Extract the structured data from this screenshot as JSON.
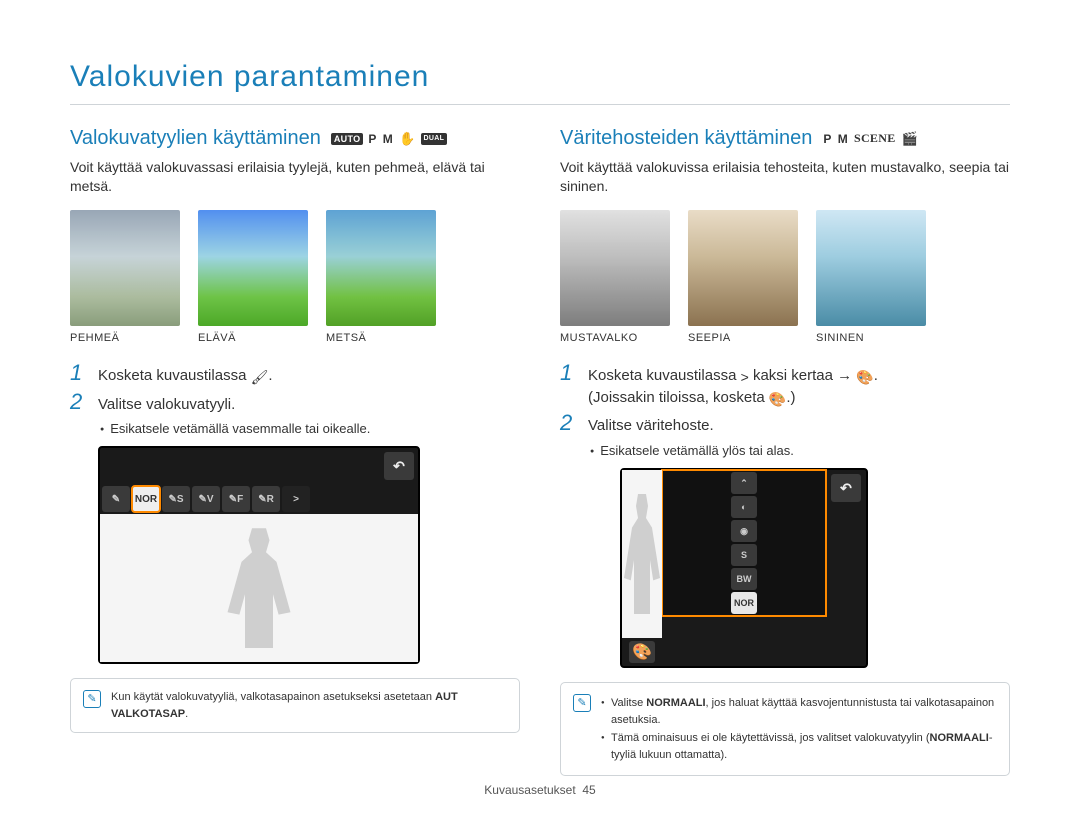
{
  "page": {
    "title": "Valokuvien parantaminen",
    "footer_section": "Kuvausasetukset",
    "footer_page": "45"
  },
  "left": {
    "title": "Valokuvatyylien käyttäminen",
    "modes": {
      "auto": "AUTO",
      "p": "P",
      "m": "M",
      "dual": "DUAL"
    },
    "intro": "Voit käyttää valokuvassasi erilaisia tyylejä, kuten pehmeä, elävä tai metsä.",
    "thumbs": [
      {
        "label": "PEHMEÄ"
      },
      {
        "label": "ELÄVÄ"
      },
      {
        "label": "METSÄ"
      }
    ],
    "step1": "Kosketa kuvaustilassa",
    "step1_icon": "🖌",
    "step2": "Valitse valokuvatyyli.",
    "bullet": "Esikatsele vetämällä vasemmalle tai oikealle.",
    "screen": {
      "back": "↶",
      "options": [
        "✎",
        "NOR",
        "✎S",
        "✎V",
        "✎F",
        "✎R"
      ],
      "next": ">"
    },
    "note": {
      "text_a": "Kun käytät valokuvatyyliä, valkotasapainon asetukseksi asetetaan ",
      "text_b": "AUT VALKOTASAP",
      "text_c": "."
    }
  },
  "right": {
    "title": "Väritehosteiden käyttäminen",
    "modes": {
      "p": "P",
      "m": "M",
      "scene": "SCENE"
    },
    "intro": "Voit käyttää valokuvissa erilaisia tehosteita, kuten mustavalko, seepia tai sininen.",
    "thumbs": [
      {
        "label": "MUSTAVALKO"
      },
      {
        "label": "SEEPIA"
      },
      {
        "label": "SININEN"
      }
    ],
    "step1_a": "Kosketa kuvaustilassa",
    "step1_b": "kaksi kertaa",
    "step1_c": "(Joissakin tiloissa, kosketa",
    "step1_d": ".)",
    "step1_chevron": ">",
    "step1_arrow": "→",
    "step1_icon": "🎨",
    "step2": "Valitse väritehoste.",
    "bullet": "Esikatsele vetämällä ylös tai alas.",
    "screen": {
      "back": "↶",
      "options_top": "⌃",
      "options": [
        "◐",
        "◉",
        "S",
        "BW",
        "NOR"
      ],
      "palette": "🎨"
    },
    "note": {
      "li1_a": "Valitse ",
      "li1_b": "NORMAALI",
      "li1_c": ", jos haluat käyttää kasvojentunnistusta tai valkotasapainon asetuksia.",
      "li2_a": "Tämä ominaisuus ei ole käytettävissä, jos valitset valokuvatyylin (",
      "li2_b": "NORMAALI",
      "li2_c": "-tyyliä lukuun ottamatta)."
    }
  }
}
